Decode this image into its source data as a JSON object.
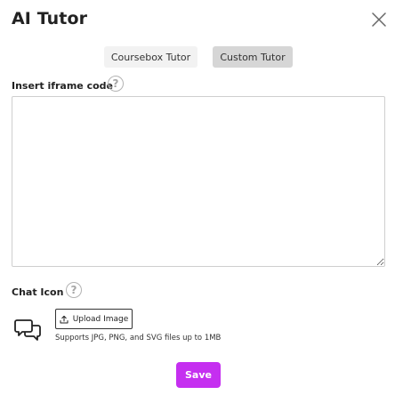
{
  "dialog": {
    "title": "AI Tutor",
    "close_icon": "close-icon"
  },
  "tabs": [
    {
      "label": "Coursebox Tutor",
      "active": false
    },
    {
      "label": "Custom Tutor",
      "active": true
    }
  ],
  "iframe_field": {
    "label": "Insert iframe code",
    "value": "",
    "help_icon": "question-circle-icon"
  },
  "chat_icon_field": {
    "label": "Chat Icon",
    "help_icon": "question-circle-icon",
    "preview_icon": "chat-bubbles-icon",
    "upload_label": "Upload Image",
    "upload_icon": "upload-icon",
    "hint": "Supports JPG, PNG, and SVG files up to 1MB"
  },
  "save_label": "Save",
  "colors": {
    "accent": "#c52ff0",
    "tab_active_bg": "#d6d6d6",
    "tab_inactive_bg": "#f2f2f2",
    "border": "#cfcfcf"
  }
}
